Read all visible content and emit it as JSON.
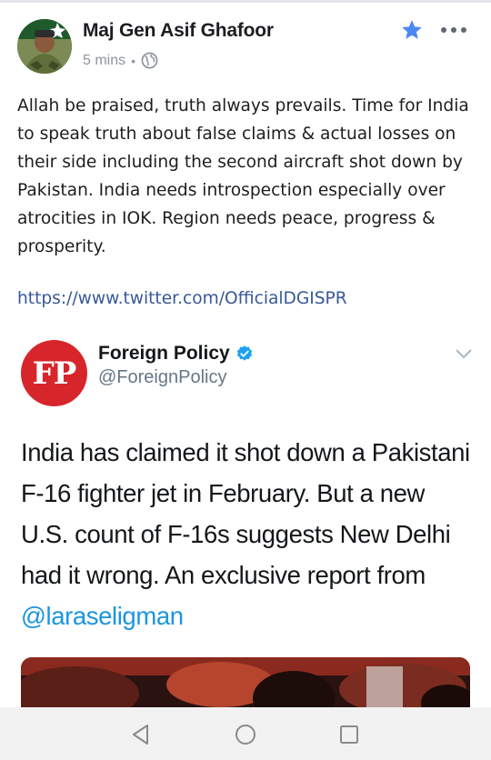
{
  "post": {
    "author": "Maj Gen Asif Ghafoor",
    "time": "5 mins",
    "separator": "•",
    "privacy_icon": "globe-icon",
    "text": "Allah be praised, truth always prevails. Time for India to speak truth about false claims & actual losses on their side including the second aircraft shot down by Pakistan. India needs introspection especially over atrocities in IOK. Region needs peace, progress & prosperity.",
    "link": "https://www.twitter.com/OfficialDGISPR"
  },
  "header_icons": {
    "star": "star-icon",
    "more": "more-options-icon"
  },
  "tweet": {
    "logo_text": "FP",
    "name": "Foreign Policy",
    "handle": "@ForeignPolicy",
    "text_before_mention": "India has claimed it shot down a Pakistani F-16 fighter jet in February. But a new U.S. count of F-16s suggests New Delhi had it wrong. An exclusive report from ",
    "mention": "@laraseligman"
  },
  "navbar": {
    "back": "back-triangle-icon",
    "home": "home-circle-icon",
    "recent": "recent-apps-square-icon"
  },
  "colors": {
    "link": "#385898",
    "mention": "#1b95e0",
    "star": "#4a89f3",
    "fp_red": "#d7262b",
    "verified": "#1da1f2"
  }
}
